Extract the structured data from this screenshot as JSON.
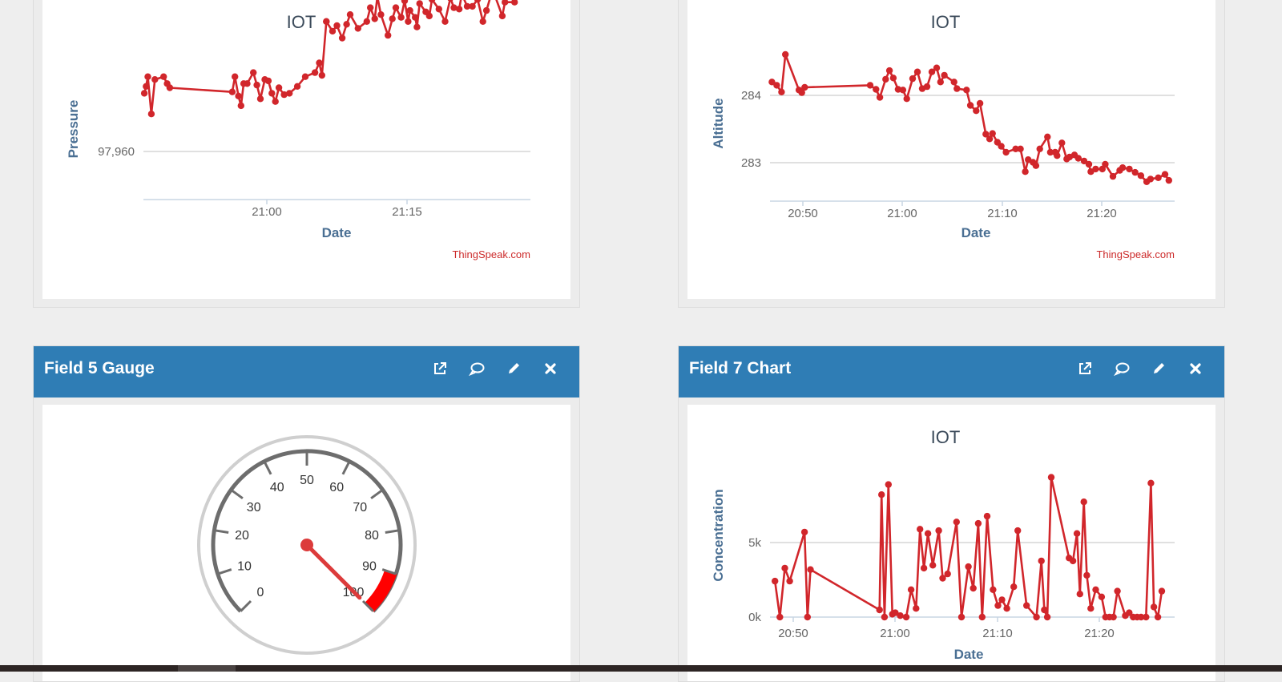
{
  "colors": {
    "accent": "#2f7db5",
    "series": "#d1262b",
    "grid": "#d6d6d6",
    "credit": "#cc2a2a"
  },
  "cards": {
    "pressure": {
      "title": "IOT",
      "ylabel": "Pressure",
      "xlabel": "Date",
      "credit": "ThingSpeak.com",
      "yticks": [
        "97,960"
      ],
      "xticks": [
        "21:00",
        "21:15"
      ]
    },
    "altitude": {
      "title": "IOT",
      "ylabel": "Altitude",
      "xlabel": "Date",
      "credit": "ThingSpeak.com",
      "yticks": [
        "284",
        "283"
      ],
      "xticks": [
        "20:50",
        "21:00",
        "21:10",
        "21:20"
      ]
    },
    "gauge": {
      "header": "Field 5 Gauge",
      "icons": [
        "external-link-icon",
        "comment-icon",
        "pencil-icon",
        "close-icon"
      ],
      "labels": [
        "0",
        "10",
        "20",
        "30",
        "40",
        "50",
        "60",
        "70",
        "80",
        "90",
        "100"
      ],
      "value": 100,
      "min": 0,
      "max": 100,
      "danger_band": [
        90,
        100
      ]
    },
    "concentration": {
      "header": "Field 7 Chart",
      "icons": [
        "external-link-icon",
        "comment-icon",
        "pencil-icon",
        "close-icon"
      ],
      "title": "IOT",
      "ylabel": "Concentration",
      "xlabel": "Date",
      "yticks": [
        "5k",
        "0k"
      ],
      "xticks": [
        "20:50",
        "21:00",
        "21:10",
        "21:20"
      ]
    }
  },
  "chart_data": [
    {
      "type": "line",
      "title": "IOT",
      "xlabel": "Date",
      "ylabel": "Pressure",
      "x_unit": "HH:MM",
      "xlim": [
        "20:47",
        "21:31"
      ],
      "ylim": [
        97951.1,
        97961.9
      ],
      "x": [
        "20:47:1",
        "20:47:3",
        "20:47:5",
        "20:47:9",
        "20:48:3",
        "20:49:3",
        "20:49:7",
        "20:50:0",
        "20:57:1",
        "20:57:4",
        "20:57:8",
        "20:58:1",
        "20:58:4",
        "20:58:8",
        "20:59:5",
        "20:59:9",
        "21:00:3",
        "21:00:8",
        "21:01:2",
        "21:01:6",
        "21:02:0",
        "21:02:4",
        "21:03:0",
        "21:03:6",
        "21:04:5",
        "21:05:4",
        "21:06:5",
        "21:07:0",
        "21:07:3",
        "21:07:8",
        "21:07:8",
        "21:08:5",
        "21:09:0",
        "21:09:6",
        "21:10:1",
        "21:10:5",
        "21:11:4",
        "21:12:4",
        "21:12:8",
        "21:13:3",
        "21:13:6",
        "21:14:0",
        "21:14:8",
        "21:15:3",
        "21:15:7",
        "21:16:3",
        "21:16:7",
        "21:17:1",
        "21:17:3",
        "21:17:9",
        "21:18:1",
        "21:18:4",
        "21:19:1",
        "21:19:5",
        "21:19:8",
        "21:20:6",
        "21:21:3",
        "21:21:9",
        "21:22:3",
        "21:22:9",
        "21:23:2",
        "21:23:8",
        "21:24:4",
        "21:25:0",
        "21:25:6",
        "21:26:0",
        "21:26:6",
        "21:27:0",
        "21:27:8",
        "21:28:1",
        "21:29:2",
        "21:29:8",
        "21:30:2"
      ],
      "series": [
        {
          "values": [
            97958.8,
            97959.3,
            97960.0,
            97957.3,
            97959.8,
            97960.0,
            97959.5,
            97959.2,
            97958.9,
            97960.0,
            97958.6,
            97957.9,
            97959.5,
            97959.5,
            97960.3,
            97959.4,
            97958.4,
            97959.8,
            97959.7,
            97958.8,
            97958.2,
            97959.2,
            97958.7,
            97958.8,
            97959.3,
            97960.0,
            97960.3,
            97961.0,
            97960.1,
            97964.0,
            97964.0,
            97963.3,
            97963.7,
            97962.8,
            97963.8,
            97964.5,
            97963.5,
            97964.0,
            97965.0,
            97964.2,
            97965.8,
            97964.5,
            97963.0,
            97964.2,
            97965.0,
            97964.3,
            97965.5,
            97964.0,
            97964.8,
            97964.3,
            97963.6,
            97965.3,
            97964.7,
            97964.4,
            97965.6,
            97964.9,
            97964.0,
            97965.7,
            97965.0,
            97964.9,
            97966.0,
            97965.1,
            97965.1,
            97965.6,
            97964.0,
            97964.8,
            97966.1,
            97965.8,
            97964.4,
            97965.4,
            97965.4,
            97966.2,
            97966.5
          ]
        }
      ]
    },
    {
      "type": "line",
      "title": "IOT",
      "xlabel": "Date",
      "ylabel": "Altitude",
      "x_unit": "HH:MM",
      "xlim": [
        "20:47",
        "21:29"
      ],
      "ylim": [
        282.42,
        284.67
      ],
      "x": [
        "20:47:2",
        "20:47:7",
        "20:48:2",
        "20:48:6",
        "20:50:0",
        "20:50:3",
        "20:50:6",
        "20:57:4",
        "20:58:0",
        "20:58:4",
        "20:59:0",
        "20:59:4",
        "20:59:8",
        "21:00:3",
        "21:00:8",
        "21:01:2",
        "21:01:8",
        "21:02:3",
        "21:02:8",
        "21:03:3",
        "21:03:8",
        "21:04:3",
        "21:04:7",
        "21:05:1",
        "21:06:1",
        "21:06:4",
        "21:07:4",
        "21:07:8",
        "21:08:4",
        "21:08:8",
        "21:09:4",
        "21:09:8",
        "21:10:1",
        "21:10:6",
        "21:11:0",
        "21:11:5",
        "21:12:5",
        "21:13:0",
        "21:13:5",
        "21:13:8",
        "21:14:3",
        "21:14:6",
        "21:15:0",
        "21:15:8",
        "21:16:1",
        "21:16:6",
        "21:16:8",
        "21:17:3",
        "21:17:8",
        "21:18:1",
        "21:18:6",
        "21:19:0",
        "21:19:6",
        "21:20:1",
        "21:20:3",
        "21:20:8",
        "21:21:5",
        "21:21:8",
        "21:22:6",
        "21:23:3",
        "21:23:6",
        "21:24:3",
        "21:24:9",
        "21:25:5",
        "21:26:1",
        "21:26:5",
        "21:27:3",
        "21:28:0",
        "21:28:4"
      ],
      "series": [
        {
          "values": [
            284.2,
            284.15,
            284.05,
            284.61,
            284.08,
            284.04,
            284.12,
            284.15,
            284.09,
            283.97,
            284.24,
            284.37,
            284.26,
            284.09,
            284.08,
            283.95,
            284.25,
            284.35,
            284.1,
            284.13,
            284.35,
            284.41,
            284.2,
            284.3,
            284.2,
            284.1,
            284.08,
            283.85,
            283.77,
            283.88,
            283.42,
            283.35,
            283.43,
            283.3,
            283.24,
            283.15,
            283.2,
            283.2,
            282.86,
            283.04,
            283.0,
            282.95,
            283.2,
            283.38,
            283.15,
            283.15,
            283.1,
            283.29,
            283.05,
            283.08,
            283.11,
            283.06,
            283.02,
            282.97,
            282.86,
            282.9,
            282.9,
            282.97,
            282.79,
            282.88,
            282.92,
            282.9,
            282.85,
            282.8,
            282.71,
            282.75,
            282.77,
            282.82,
            282.73
          ]
        }
      ]
    },
    {
      "type": "line",
      "title": "IOT",
      "xlabel": "Date",
      "ylabel": "Concentration",
      "x_unit": "HH:MM",
      "xlim": [
        "20:47",
        "21:28"
      ],
      "ylim": [
        0,
        9900
      ],
      "x": [
        "20:47:5",
        "20:48:0",
        "20:48:5",
        "20:49:0",
        "20:50:5",
        "20:50:8",
        "20:51:1",
        "20:58:1",
        "20:58:3",
        "20:58:6",
        "20:59:0",
        "20:59:4",
        "20:59:7",
        "21:00:2",
        "21:00:8",
        "21:01:3",
        "21:01:8",
        "21:02:2",
        "21:02:6",
        "21:03:0",
        "21:03:5",
        "21:04:1",
        "21:04:5",
        "21:05:0",
        "21:05:9",
        "21:06:4",
        "21:07:1",
        "21:07:6",
        "21:08:1",
        "21:08:5",
        "21:09:0",
        "21:09:6",
        "21:10:1",
        "21:10:5",
        "21:11:0",
        "21:11:7",
        "21:12:1",
        "21:13:0",
        "21:14:0",
        "21:14:5",
        "21:14:8",
        "21:15:1",
        "21:15:5",
        "21:17:3",
        "21:17:7",
        "21:18:1",
        "21:18:4",
        "21:18:8",
        "21:19:1",
        "21:19:5",
        "21:20:0",
        "21:20:6",
        "21:21:0",
        "21:21:4",
        "21:21:8",
        "21:22:2",
        "21:23:0",
        "21:23:4",
        "21:23:8",
        "21:24:2",
        "21:24:6",
        "21:25:1",
        "21:25:6",
        "21:25:9",
        "21:26:3",
        "21:26:7"
      ],
      "series": [
        {
          "values": [
            2500,
            0,
            3400,
            2500,
            5900,
            0,
            3300,
            500,
            8500,
            0,
            9200,
            200,
            300,
            100,
            0,
            1900,
            600,
            6100,
            3400,
            5800,
            3600,
            6000,
            2700,
            3000,
            6600,
            0,
            3500,
            2000,
            6500,
            0,
            7000,
            1900,
            800,
            1200,
            600,
            2100,
            6000,
            800,
            0,
            3900,
            500,
            0,
            9700,
            4100,
            3900,
            5800,
            1600,
            8000,
            2900,
            600,
            1900,
            1400,
            0,
            0,
            0,
            1800,
            100,
            300,
            0,
            0,
            0,
            0,
            9300,
            700,
            0,
            1800
          ]
        }
      ]
    }
  ]
}
